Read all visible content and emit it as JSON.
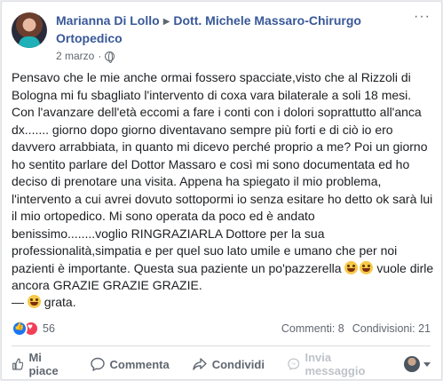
{
  "post": {
    "author": "Marianna Di Lollo",
    "target_page": "Dott. Michele Massaro-Chirurgo Ortopedico",
    "date": "2 marzo",
    "audience_icon": "globe-icon",
    "more_icon": "more-horizontal-icon",
    "body": "Pensavo che le mie anche ormai fossero spacciate,visto che al Rizzoli di Bologna mi fu sbagliato l'intervento di coxa vara bilaterale a soli 18 mesi. Con l'avanzare dell'età eccomi a fare i conti con i dolori soprattutto all'anca dx....... giorno dopo giorno diventavano sempre più forti e di ciò io ero davvero arrabbiata, in quanto mi dicevo perché proprio a me? Poi un giorno ho sentito parlare del Dottor Massaro e così mi sono documentata ed ho deciso di prenotare una visita. Appena ha spiegato il mio problema, l'intervento a cui avrei dovuto sottopormi io senza esitare ho detto ok sarà lui il mio ortopedico. Mi sono operata da poco ed è andato benissimo........voglio RINGRAZIARLA Dottore per la sua professionalità,simpatia e per quel suo lato umile e umano che per noi pazienti è importante. Questa sua paziente un po'pazzerella ",
    "body_tail": " vuole dirle ancora GRAZIE GRAZIE GRAZIE.",
    "signature_prefix": "— ",
    "signature_suffix": " grata."
  },
  "stats": {
    "reaction_count": "56",
    "comments": "Commenti: 8",
    "shares": "Condivisioni: 21"
  },
  "actions": {
    "like": "Mi piace",
    "comment": "Commenta",
    "share": "Condividi",
    "message": "Invia messaggio"
  },
  "colors": {
    "link": "#385898",
    "like_blue": "#1877f2",
    "love_red": "#f33e58"
  }
}
